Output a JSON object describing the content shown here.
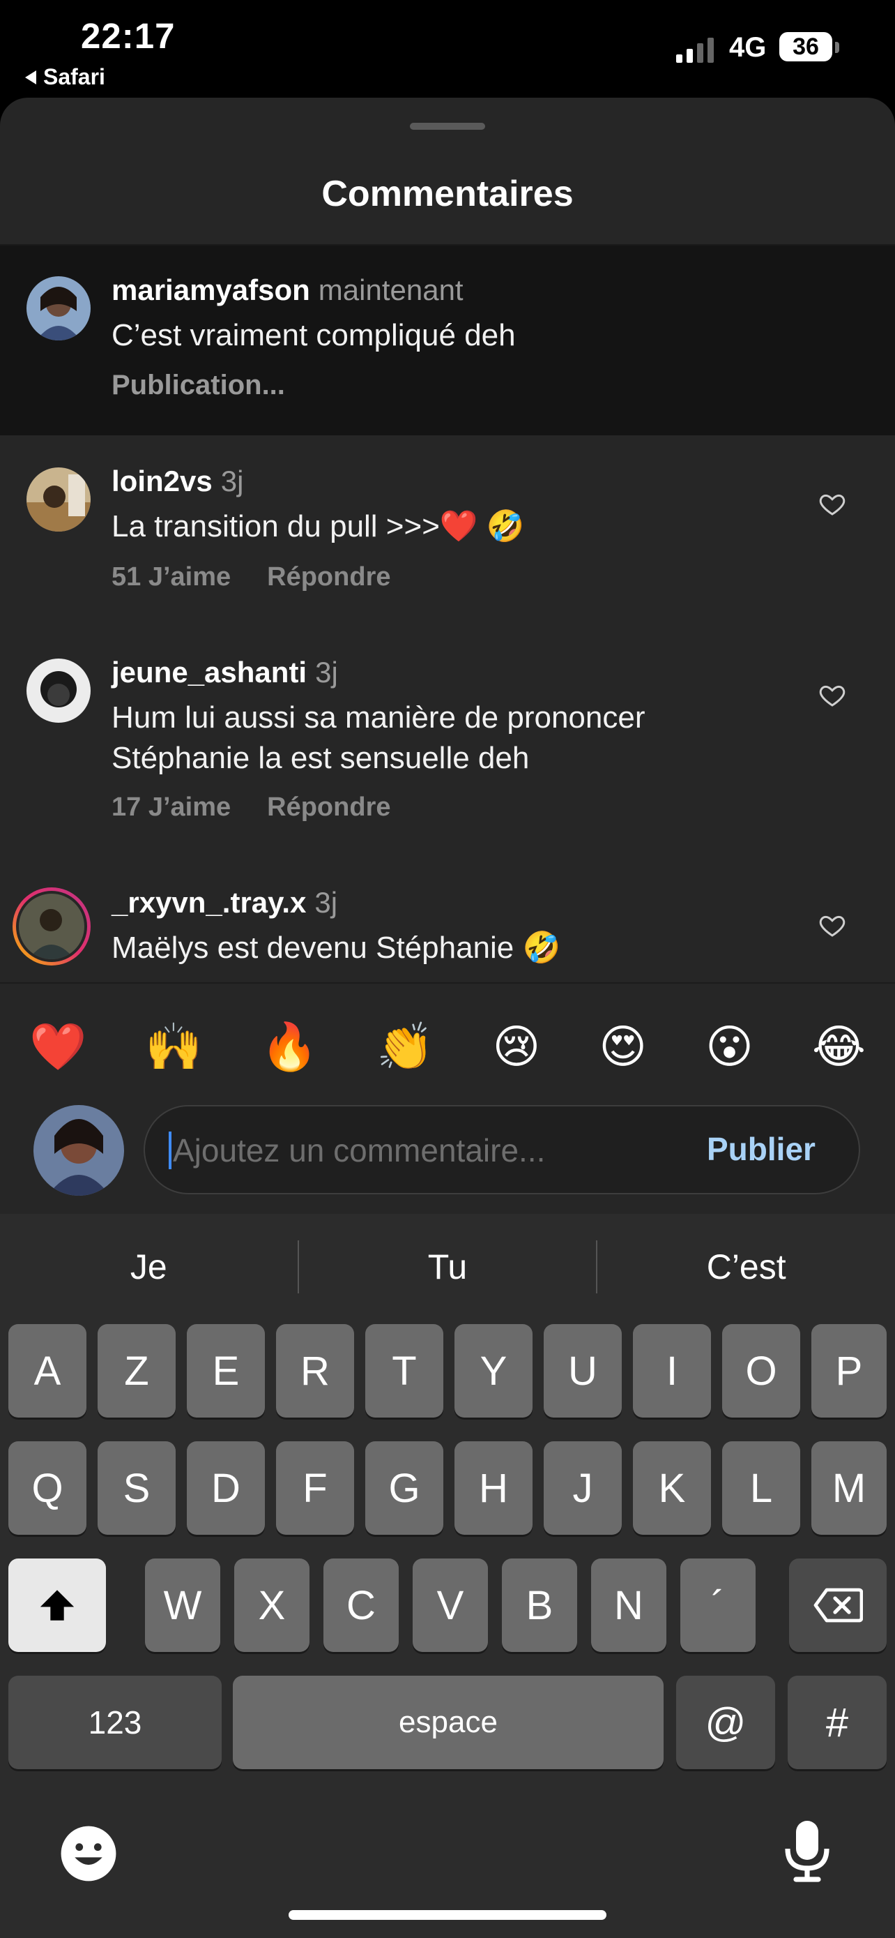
{
  "status_bar": {
    "time": "22:17",
    "back_app": "Safari",
    "network": "4G",
    "battery": "36"
  },
  "sheet": {
    "title": "Commentaires"
  },
  "pending_comment": {
    "username": "mariamyafson",
    "time": "maintenant",
    "text": "C’est vraiment compliqué deh",
    "status": "Publication..."
  },
  "comments": [
    {
      "username": "loin2vs",
      "time": "3j",
      "text": "La transition du pull >>>❤️ 🤣",
      "likes": "51 J’aime",
      "reply": "Répondre"
    },
    {
      "username": "jeune_ashanti",
      "time": "3j",
      "text_line1": "Hum lui aussi sa manière de prononcer",
      "text_line2": "Stéphanie la est sensuelle deh",
      "likes": "17 J’aime",
      "reply": "Répondre"
    },
    {
      "username": "_rxyvn_.tray.x",
      "time": "3j",
      "text": "Maëlys est devenu Stéphanie 🤣"
    }
  ],
  "reactions": [
    "❤️",
    "🙌",
    "🔥",
    "👏",
    "😢",
    "😍",
    "😮",
    "😂"
  ],
  "composer": {
    "placeholder": "Ajoutez un commentaire...",
    "publish_label": "Publier"
  },
  "keyboard": {
    "suggestions": [
      "Je",
      "Tu",
      "C’est"
    ],
    "row1": [
      "A",
      "Z",
      "E",
      "R",
      "T",
      "Y",
      "U",
      "I",
      "O",
      "P"
    ],
    "row2": [
      "Q",
      "S",
      "D",
      "F",
      "G",
      "H",
      "J",
      "K",
      "L",
      "M"
    ],
    "row3": [
      "W",
      "X",
      "C",
      "V",
      "B",
      "N",
      "´"
    ],
    "numbers_label": "123",
    "space_label": "espace",
    "at_label": "@",
    "hash_label": "#"
  },
  "icons": {
    "heart": "heart-outline-icon",
    "shift": "shift-icon",
    "delete": "backspace-icon",
    "emoji": "emoji-keyboard-icon",
    "mic": "microphone-icon"
  }
}
